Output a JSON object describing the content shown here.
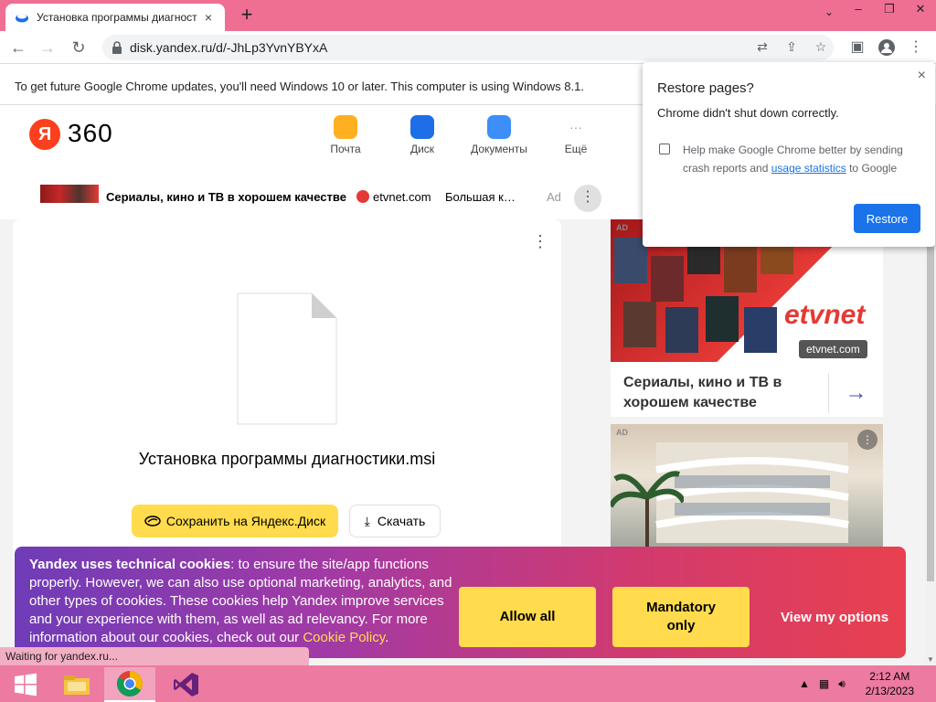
{
  "browser": {
    "tab": {
      "title": "Установка программы диагност",
      "close": "×"
    },
    "new_tab": "+",
    "window_controls": {
      "minimize": "–",
      "maximize": "❐",
      "close": "✕",
      "tab_search": "⌄"
    },
    "url": "disk.yandex.ru/d/-JhLp3YvnYBYxA",
    "infobar": "To get future Google Chrome updates, you'll need Windows 10 or later. This computer is using Windows 8.1."
  },
  "header": {
    "logo_letter": "Я",
    "logo_text": "360",
    "services": [
      {
        "label": "Почта",
        "color": "#ffb020"
      },
      {
        "label": "Диск",
        "color": "#1e6ee8"
      },
      {
        "label": "Документы",
        "color": "#3d8ef8"
      },
      {
        "label": "Ещё",
        "color": "#ffffff"
      }
    ],
    "more_dots": "···"
  },
  "ad_strip": {
    "title": "Сериалы, кино и ТВ в хорошем качестве",
    "brand": "etvnet.com",
    "desc": "Большая к…",
    "label": "Ad",
    "more": "⋮"
  },
  "file_card": {
    "more": "⋮",
    "filename": "Установка программы диагностики.msi",
    "save_label": "Сохранить на Яндекс.Диск",
    "download_label": "Скачать"
  },
  "side_ad": {
    "ad_label": "AD",
    "logo": "etvnet",
    "badge": "etvnet.com",
    "title": "Сериалы, кино и ТВ в хорошем качестве",
    "arrow": "→"
  },
  "side_ad2": {
    "ad_label": "AD",
    "more": "⋮"
  },
  "cookie": {
    "bold": "Yandex uses technical cookies",
    "text": ": to ensure the site/app functions properly. However, we can also use optional marketing, analytics, and other types of cookies. These cookies help Yandex improve services and your experience with them, as well as ad relevancy. For more information about our cookies, check out our ",
    "link": "Cookie Policy",
    "end": ".",
    "allow_all": "Allow all",
    "mandatory": "Mandatory only",
    "view_options": "View my options"
  },
  "status_text": "Waiting for yandex.ru...",
  "restore": {
    "title": "Restore pages?",
    "message": "Chrome didn't shut down correctly.",
    "checkbox_text_1": "Help make Google Chrome better by sending crash reports and ",
    "checkbox_link": "usage statistics",
    "checkbox_text_2": " to Google",
    "button": "Restore",
    "close": "×"
  },
  "taskbar": {
    "time": "2:12 AM",
    "date": "2/13/2023"
  }
}
